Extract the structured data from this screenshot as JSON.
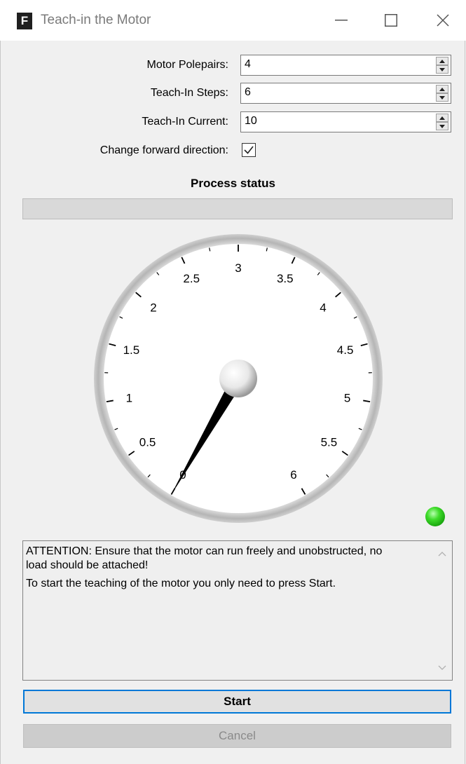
{
  "window": {
    "icon_letter": "F",
    "title": "Teach-in the Motor"
  },
  "form": {
    "pole_pairs": {
      "label": "Motor Polepairs:",
      "value": "4"
    },
    "teach_steps": {
      "label": "Teach-In Steps:",
      "value": "6"
    },
    "teach_current": {
      "label": "Teach-In Current:",
      "value": "10"
    },
    "forward_direction": {
      "label": "Change forward direction:",
      "checked": true
    }
  },
  "status": {
    "heading": "Process status",
    "progress": 0
  },
  "gauge": {
    "min": 0,
    "max": 6,
    "value": 0,
    "tick_labels": [
      "0",
      "0.5",
      "1",
      "1.5",
      "2",
      "2.5",
      "3",
      "3.5",
      "4",
      "4.5",
      "5",
      "5.5",
      "6"
    ],
    "indicator_color": "#2ecc1a"
  },
  "message": {
    "lines": [
      "ATTENTION: Ensure that the motor can run freely and unobstructed, no",
      "load should be attached!",
      "To start the teaching of the motor you only need to press Start."
    ]
  },
  "buttons": {
    "start": "Start",
    "cancel": "Cancel"
  },
  "colors": {
    "accent": "#0078d7",
    "window_bg": "#f0f0f0"
  }
}
